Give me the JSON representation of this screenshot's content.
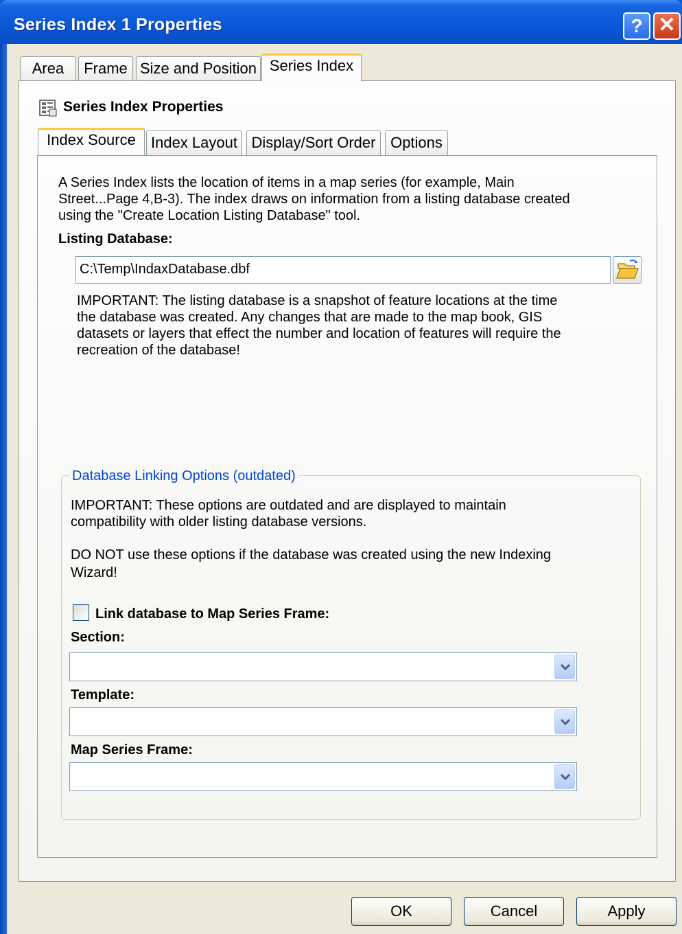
{
  "window": {
    "title": "Series Index 1 Properties",
    "help_glyph": "?",
    "close_glyph": "✕"
  },
  "tabs": [
    "Area",
    "Frame",
    "Size and Position",
    "Series Index"
  ],
  "section_title": "Series Index Properties",
  "subtabs": [
    "Index Source",
    "Index Layout",
    "Display/Sort Order",
    "Options"
  ],
  "index_source": {
    "description_lines": [
      "A Series Index lists the location of items in a map series (for example, Main",
      "Street...Page 4,B-3).  The index draws on information from a listing database created",
      "using the \"Create Location Listing Database\" tool."
    ],
    "listing_label": "Listing Database:",
    "listing_value": "C:\\Temp\\IndaxDatabase.dbf",
    "important_lines": [
      "IMPORTANT:  The listing database is a snapshot of feature locations at the time",
      "the database was created.  Any changes that are made to the map book, GIS",
      "datasets or layers that effect the number and location of features will require the",
      "recreation of the database!"
    ]
  },
  "linking": {
    "legend": "Database Linking Options (outdated)",
    "important_lines": [
      "IMPORTANT: These options are outdated and are displayed to maintain",
      "compatibility with older listing database versions."
    ],
    "donot_lines": [
      "DO NOT use these options if the database was created using the new Indexing",
      "Wizard!"
    ],
    "checkbox_label": "Link database to Map Series Frame:",
    "checkbox_checked": false,
    "section_label": "Section:",
    "section_value": "",
    "template_label": "Template:",
    "template_value": "",
    "frame_label": "Map Series Frame:",
    "frame_value": ""
  },
  "buttons": {
    "ok": "OK",
    "cancel": "Cancel",
    "apply": "Apply"
  },
  "icons": {
    "section_icon": "series-index-icon",
    "folder": "folder-open-icon",
    "dropdown": "chevron-down-icon"
  }
}
